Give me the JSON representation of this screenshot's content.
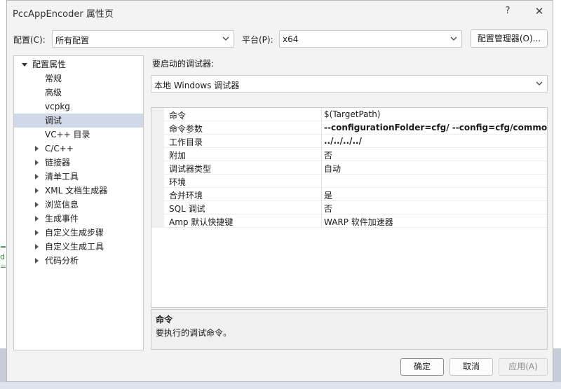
{
  "window": {
    "title": "PccAppEncoder 属性页",
    "help_glyph": "?",
    "close_glyph": "✕"
  },
  "toolbar": {
    "config_label": "配置(C):",
    "config_value": "所有配置",
    "platform_label": "平台(P):",
    "platform_value": "x64",
    "config_manager_label": "配置管理器(O)..."
  },
  "debugger": {
    "label": "要启动的调试器:",
    "value": "本地 Windows 调试器"
  },
  "tree": {
    "root": "配置属性",
    "items": [
      {
        "label": "常规",
        "expandable": false,
        "selected": false
      },
      {
        "label": "高级",
        "expandable": false,
        "selected": false
      },
      {
        "label": "vcpkg",
        "expandable": false,
        "selected": false
      },
      {
        "label": "调试",
        "expandable": false,
        "selected": true
      },
      {
        "label": "VC++ 目录",
        "expandable": false,
        "selected": false
      },
      {
        "label": "C/C++",
        "expandable": true,
        "selected": false
      },
      {
        "label": "链接器",
        "expandable": true,
        "selected": false
      },
      {
        "label": "清单工具",
        "expandable": true,
        "selected": false
      },
      {
        "label": "XML 文档生成器",
        "expandable": true,
        "selected": false
      },
      {
        "label": "浏览信息",
        "expandable": true,
        "selected": false
      },
      {
        "label": "生成事件",
        "expandable": true,
        "selected": false
      },
      {
        "label": "自定义生成步骤",
        "expandable": true,
        "selected": false
      },
      {
        "label": "自定义生成工具",
        "expandable": true,
        "selected": false
      },
      {
        "label": "代码分析",
        "expandable": true,
        "selected": false
      }
    ]
  },
  "grid": {
    "rows": [
      {
        "name": "命令",
        "value": "$(TargetPath)",
        "bold": false
      },
      {
        "name": "命令参数",
        "value": "--configurationFolder=cfg/ --config=cfg/common/c",
        "bold": true
      },
      {
        "name": "工作目录",
        "value": "../../../../",
        "bold": true
      },
      {
        "name": "附加",
        "value": "否",
        "bold": false
      },
      {
        "name": "调试器类型",
        "value": "自动",
        "bold": false
      },
      {
        "name": "环境",
        "value": "",
        "bold": false
      },
      {
        "name": "合并环境",
        "value": "是",
        "bold": false
      },
      {
        "name": "SQL 调试",
        "value": "否",
        "bold": false
      },
      {
        "name": "Amp 默认快捷键",
        "value": "WARP 软件加速器",
        "bold": false
      }
    ]
  },
  "description": {
    "title": "命令",
    "text": "要执行的调试命令。"
  },
  "buttons": {
    "ok": "确定",
    "cancel": "取消",
    "apply": "应用(A)"
  },
  "background": {
    "glyphs": [
      "=",
      "d",
      "="
    ]
  }
}
